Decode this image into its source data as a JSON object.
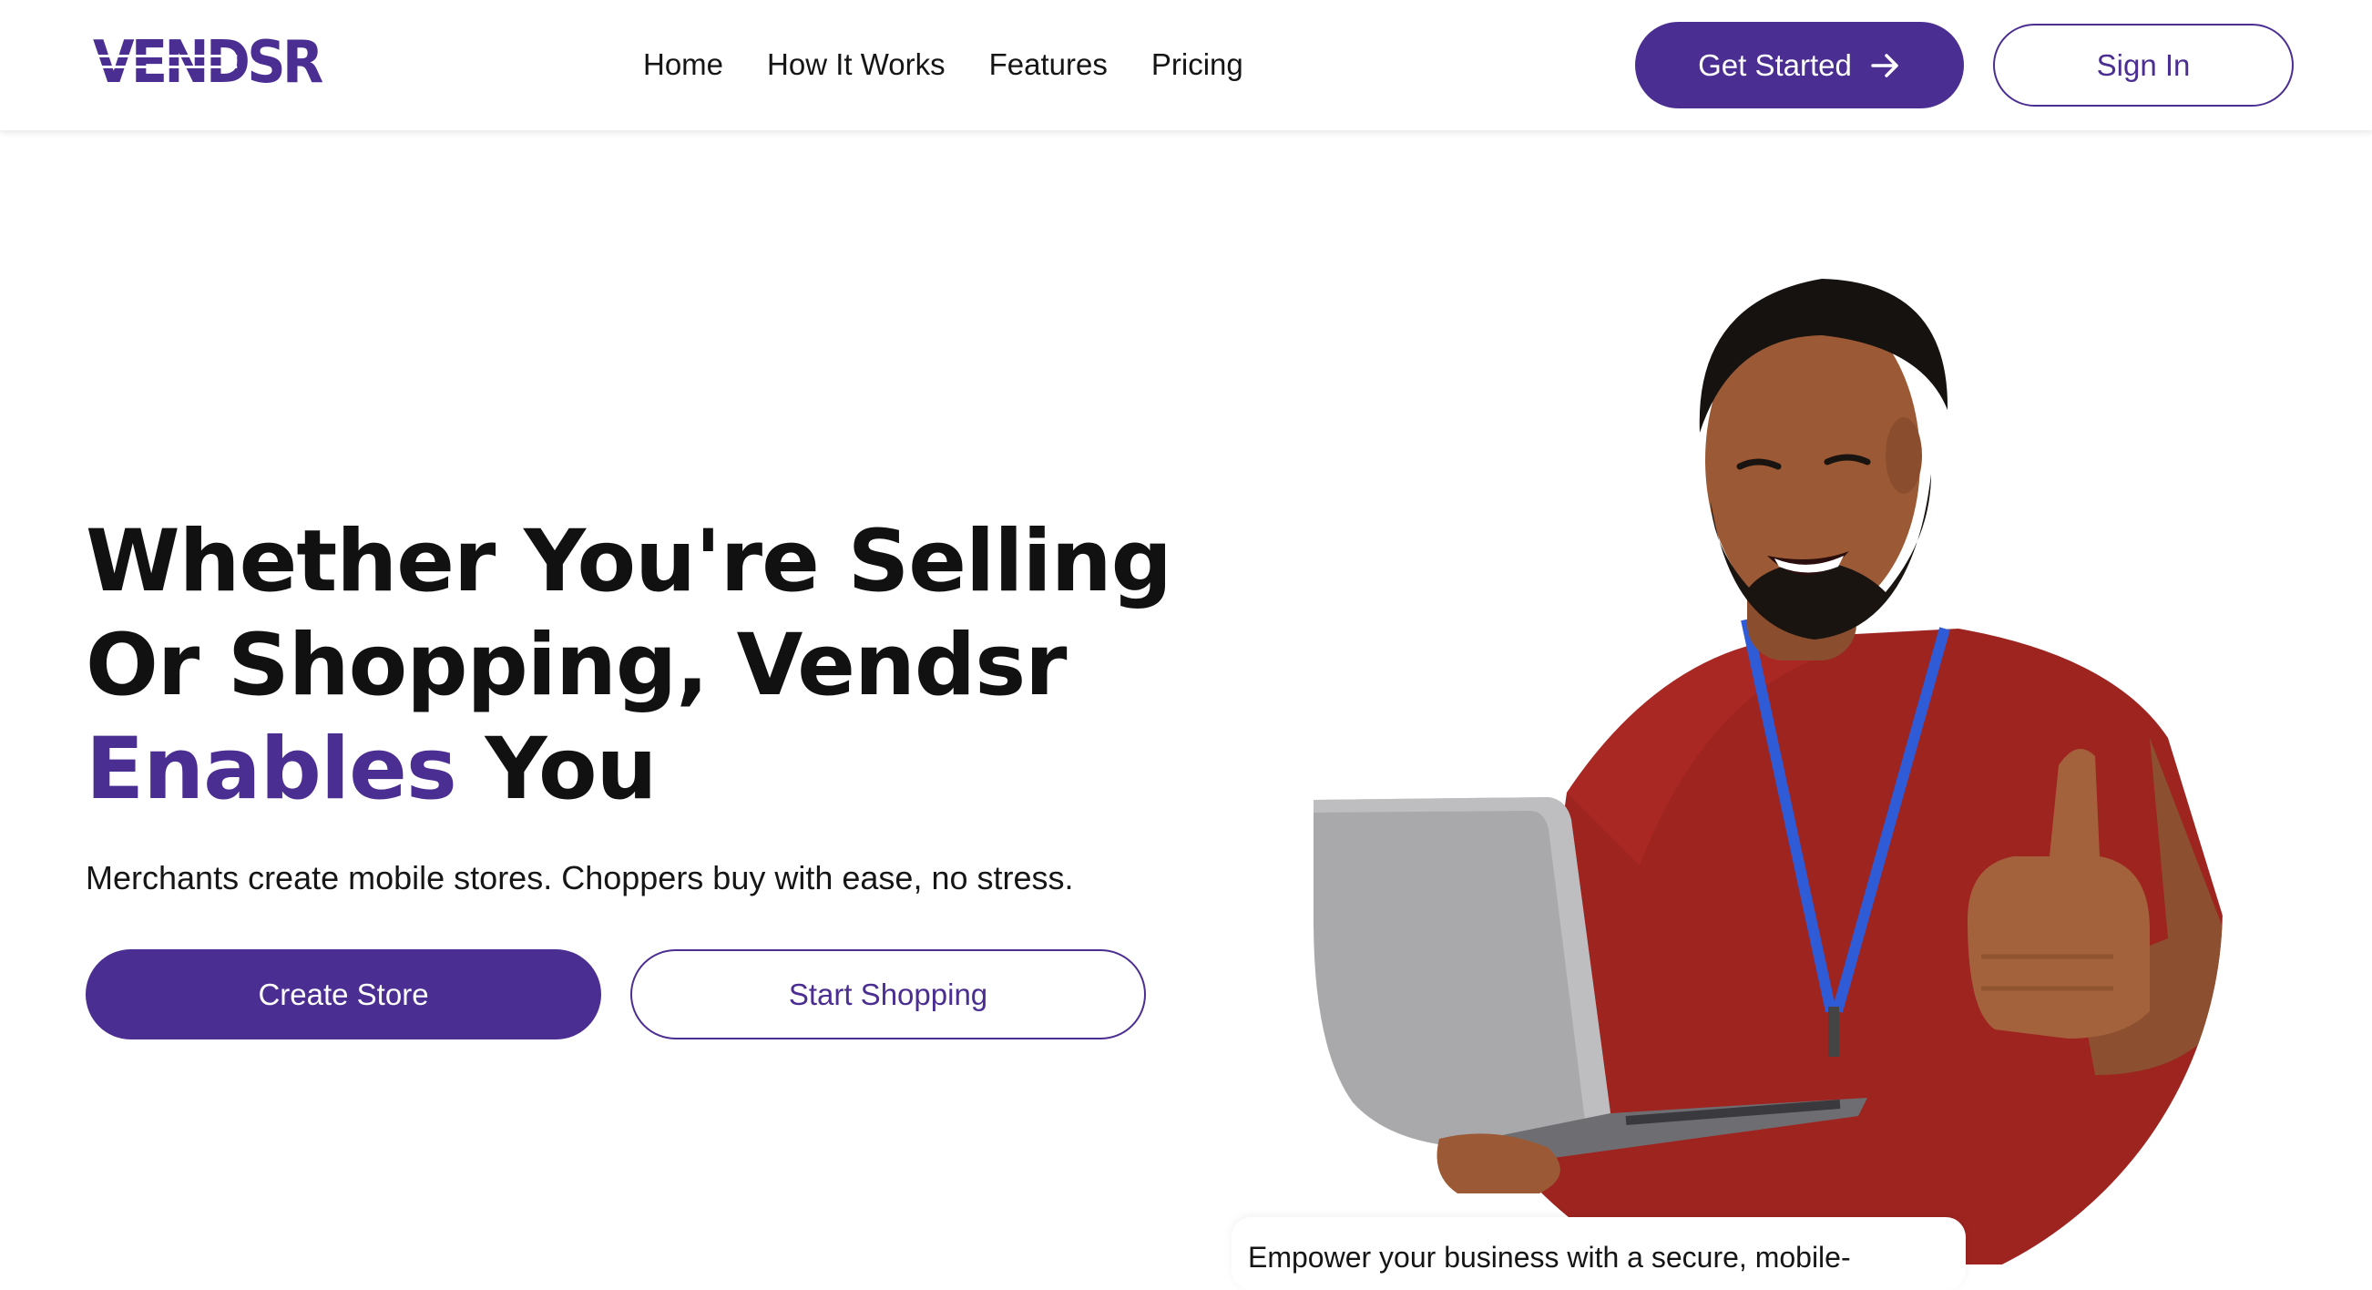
{
  "brand": {
    "logo_text": "VENDSR",
    "accent_color": "#4B2E92"
  },
  "nav": {
    "items": [
      "Home",
      "How It Works",
      "Features",
      "Pricing"
    ]
  },
  "header": {
    "get_started_label": "Get Started",
    "get_started_icon": "arrow-right-icon",
    "sign_in_label": "Sign In"
  },
  "hero": {
    "title_line1": "Whether You're Selling",
    "title_line2": "Or Shopping, Vendsr",
    "title_accent": "Enables",
    "title_end": "You",
    "subtitle": "Merchants create mobile stores. Choppers buy with ease, no stress.",
    "create_store_label": "Create Store",
    "start_shopping_label": "Start Shopping",
    "caption": "Empower your business with a secure, mobile-"
  }
}
